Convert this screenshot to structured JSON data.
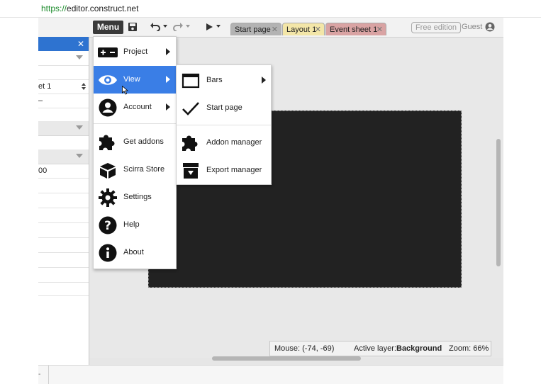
{
  "browser": {
    "url_scheme": "https://",
    "url_rest": "editor.construct.net"
  },
  "props_panel": {
    "close_glyph": "✕",
    "row_sheet": "et 1",
    "row_d": "–",
    "row_00": "00"
  },
  "toolbar": {
    "menu_label": "Menu"
  },
  "tabs": [
    {
      "label": "Start page",
      "color": "#b3b3b3"
    },
    {
      "label": "Layout 1",
      "color": "#f3e6a8"
    },
    {
      "label": "Event sheet 1",
      "color": "#d9a3a3"
    }
  ],
  "account": {
    "badge": "Free edition",
    "guest": "Guest"
  },
  "main_menu": {
    "project": "Project",
    "view": "View",
    "account": "Account",
    "get_addons": "Get addons",
    "scirra_store": "Scirra Store",
    "settings": "Settings",
    "help": "Help",
    "about": "About"
  },
  "view_menu": {
    "bars": "Bars",
    "start_page": "Start page",
    "addon_manager": "Addon manager",
    "export_manager": "Export manager"
  },
  "status": {
    "mouse": "Mouse: (-74, -69)",
    "active_layer_label": "Active layer:",
    "active_layer_value": "Background",
    "zoom": "Zoom: 66%"
  },
  "colors": {
    "accent": "#2e73d0",
    "highlight": "#3a7ee6",
    "layout_bg": "#222222"
  }
}
